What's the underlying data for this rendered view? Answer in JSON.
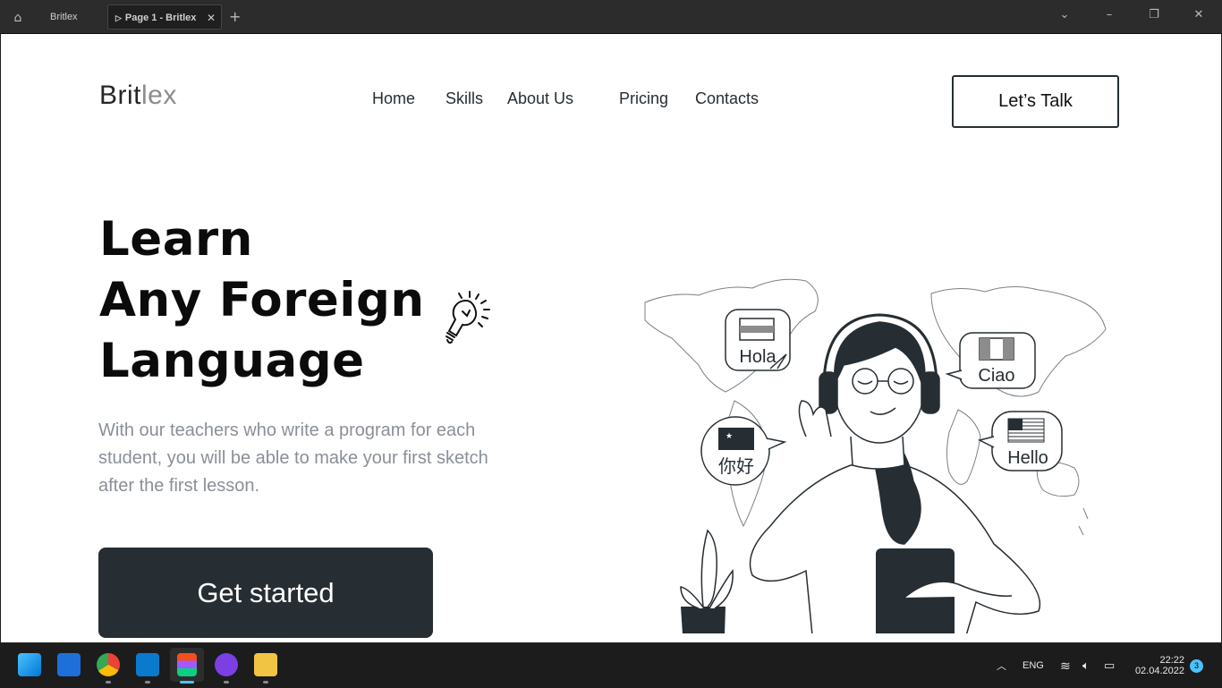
{
  "window": {
    "file_tab": "Britlex",
    "page_tab": "Page 1 - Britlex"
  },
  "site": {
    "logo_main": "Brit",
    "logo_accent": "lex",
    "nav": [
      "Home",
      "Skills",
      "About Us",
      "Pricing",
      "Contacts"
    ],
    "cta_top": "Let’s Talk",
    "hero_lines": [
      "Learn",
      "Any Foreign",
      "Language"
    ],
    "description": "With our teachers who write a program for each student, you will be able to make your first sketch after the first lesson.",
    "cta_main": "Get started",
    "bubbles": [
      "Hola",
      "Ciao",
      "你好",
      "Hello"
    ]
  },
  "taskbar": {
    "lang": "ENG",
    "time": "22:22",
    "date": "02.04.2022",
    "notifications": "3"
  },
  "colors": {
    "dark": "#262e33",
    "muted_text": "#8a8f98",
    "page_bg": "#ffffff"
  }
}
